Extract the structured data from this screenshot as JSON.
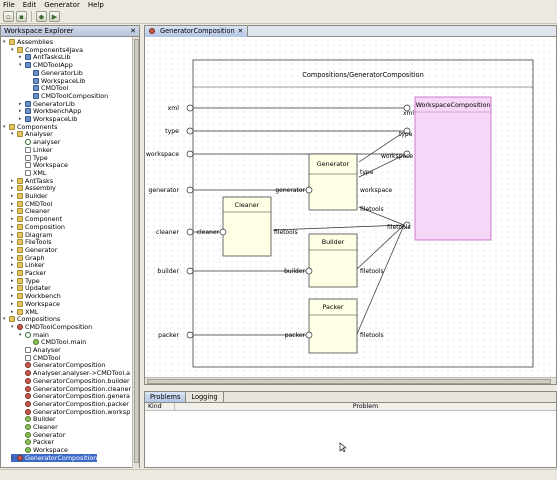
{
  "menu": [
    "File",
    "Edit",
    "Generator",
    "Help"
  ],
  "colors": {
    "selection": "#3d6bc7",
    "component_fill": "#ffffe6",
    "workspace_fill": "#f7d7f7",
    "workspace_border": "#c060c0",
    "tab_active": "#b3c5e6"
  },
  "workspace_explorer": {
    "title": "Workspace Explorer",
    "tree": [
      {
        "label": "Assemblies",
        "depth": 0,
        "icon": "folder-icon",
        "toggle": "open"
      },
      {
        "label": "Components4Java",
        "depth": 1,
        "icon": "folder-icon",
        "toggle": "open"
      },
      {
        "label": "AntTasksLib",
        "depth": 2,
        "icon": "package-icon",
        "toggle": "closed"
      },
      {
        "label": "CMDToolApp",
        "depth": 2,
        "icon": "package-icon",
        "toggle": "open"
      },
      {
        "label": "GeneratorLib",
        "depth": 3,
        "icon": "package-icon",
        "toggle": ""
      },
      {
        "label": "WorkspaceLib",
        "depth": 3,
        "icon": "package-icon",
        "toggle": ""
      },
      {
        "label": "CMDTool",
        "depth": 3,
        "icon": "package-icon",
        "toggle": ""
      },
      {
        "label": "CMDToolComposition",
        "depth": 3,
        "icon": "package-icon",
        "toggle": ""
      },
      {
        "label": "GeneratorLib",
        "depth": 2,
        "icon": "package-icon",
        "toggle": "closed"
      },
      {
        "label": "WorkbenchApp",
        "depth": 2,
        "icon": "package-icon",
        "toggle": "closed"
      },
      {
        "label": "WorkspaceLib",
        "depth": 2,
        "icon": "package-icon",
        "toggle": "closed"
      },
      {
        "label": "Components",
        "depth": 0,
        "icon": "folder-icon",
        "toggle": "open"
      },
      {
        "label": "Analyser",
        "depth": 1,
        "icon": "folder-icon",
        "toggle": "open"
      },
      {
        "label": "analyser",
        "depth": 2,
        "icon": "search-icon",
        "toggle": ""
      },
      {
        "label": "Linker",
        "depth": 2,
        "icon": "file-icon",
        "toggle": ""
      },
      {
        "label": "Type",
        "depth": 2,
        "icon": "file-icon",
        "toggle": ""
      },
      {
        "label": "Workspace",
        "depth": 2,
        "icon": "file-icon",
        "toggle": ""
      },
      {
        "label": "XML",
        "depth": 2,
        "icon": "file-icon",
        "toggle": ""
      },
      {
        "label": "AntTasks",
        "depth": 1,
        "icon": "folder-icon",
        "toggle": "closed"
      },
      {
        "label": "Assembly",
        "depth": 1,
        "icon": "folder-icon",
        "toggle": "closed"
      },
      {
        "label": "Builder",
        "depth": 1,
        "icon": "folder-icon",
        "toggle": "closed"
      },
      {
        "label": "CMDTool",
        "depth": 1,
        "icon": "folder-icon",
        "toggle": "closed"
      },
      {
        "label": "Cleaner",
        "depth": 1,
        "icon": "folder-icon",
        "toggle": "closed"
      },
      {
        "label": "Component",
        "depth": 1,
        "icon": "folder-icon",
        "toggle": "closed"
      },
      {
        "label": "Composition",
        "depth": 1,
        "icon": "folder-icon",
        "toggle": "closed"
      },
      {
        "label": "Diagram",
        "depth": 1,
        "icon": "folder-icon",
        "toggle": "closed"
      },
      {
        "label": "FileTools",
        "depth": 1,
        "icon": "folder-icon",
        "toggle": "closed"
      },
      {
        "label": "Generator",
        "depth": 1,
        "icon": "folder-icon",
        "toggle": "closed"
      },
      {
        "label": "Graph",
        "depth": 1,
        "icon": "folder-icon",
        "toggle": "closed"
      },
      {
        "label": "Linker",
        "depth": 1,
        "icon": "folder-icon",
        "toggle": "closed"
      },
      {
        "label": "Packer",
        "depth": 1,
        "icon": "folder-icon",
        "toggle": "closed"
      },
      {
        "label": "Type",
        "depth": 1,
        "icon": "folder-icon",
        "toggle": "closed"
      },
      {
        "label": "Updater",
        "depth": 1,
        "icon": "folder-icon",
        "toggle": "closed"
      },
      {
        "label": "Workbench",
        "depth": 1,
        "icon": "folder-icon",
        "toggle": "closed"
      },
      {
        "label": "Workspace",
        "depth": 1,
        "icon": "folder-icon",
        "toggle": "closed"
      },
      {
        "label": "XML",
        "depth": 1,
        "icon": "folder-icon",
        "toggle": "closed"
      },
      {
        "label": "Compositions",
        "depth": 0,
        "icon": "folder-icon",
        "toggle": "open"
      },
      {
        "label": "CMDToolComposition",
        "depth": 1,
        "icon": "composition-icon",
        "toggle": "open"
      },
      {
        "label": "main",
        "depth": 2,
        "icon": "search-icon",
        "toggle": "open"
      },
      {
        "label": "CMDTool.main",
        "depth": 3,
        "icon": "function-icon",
        "toggle": ""
      },
      {
        "label": "Analyser",
        "depth": 2,
        "icon": "file-icon",
        "toggle": ""
      },
      {
        "label": "CMDTool",
        "depth": 2,
        "icon": "file-icon",
        "toggle": ""
      },
      {
        "label": "GeneratorComposition",
        "depth": 2,
        "icon": "composition-icon",
        "toggle": ""
      },
      {
        "label": "Analyser.analyser->CMDTool.a",
        "depth": 2,
        "icon": "composition-icon",
        "toggle": ""
      },
      {
        "label": "GeneratorComposition.builder",
        "depth": 2,
        "icon": "composition-icon",
        "toggle": ""
      },
      {
        "label": "GeneratorComposition.cleaner",
        "depth": 2,
        "icon": "composition-icon",
        "toggle": ""
      },
      {
        "label": "GeneratorComposition.genera",
        "depth": 2,
        "icon": "composition-icon",
        "toggle": ""
      },
      {
        "label": "GeneratorComposition.packer",
        "depth": 2,
        "icon": "composition-icon",
        "toggle": ""
      },
      {
        "label": "GeneratorComposition.worksp",
        "depth": 2,
        "icon": "composition-icon",
        "toggle": ""
      },
      {
        "label": "Builder",
        "depth": 2,
        "icon": "fn-icon",
        "toggle": ""
      },
      {
        "label": "Cleaner",
        "depth": 2,
        "icon": "fn-icon",
        "toggle": ""
      },
      {
        "label": "Generator",
        "depth": 2,
        "icon": "fn-icon",
        "toggle": ""
      },
      {
        "label": "Packer",
        "depth": 2,
        "icon": "fn-icon",
        "toggle": ""
      },
      {
        "label": "Workspace",
        "depth": 2,
        "icon": "fn-icon",
        "toggle": ""
      },
      {
        "label": "GeneratorComposition",
        "depth": 1,
        "icon": "composition-icon",
        "toggle": "closed",
        "selected": true
      }
    ]
  },
  "editor": {
    "tab_label": "GeneratorComposition",
    "diagram": {
      "frame_title": "Compositions/GeneratorComposition",
      "boundary_ports": [
        "xml",
        "type",
        "workspace",
        "generator",
        "cleaner",
        "builder",
        "packer"
      ],
      "components": {
        "generator": {
          "title": "Generator",
          "ports": [
            "generator",
            "type",
            "workspace",
            "filetools"
          ]
        },
        "cleaner": {
          "title": "Cleaner",
          "ports": [
            "cleaner",
            "filetools"
          ]
        },
        "builder": {
          "title": "Builder",
          "ports": [
            "builder",
            "filetools"
          ]
        },
        "packer": {
          "title": "Packer",
          "ports": [
            "packer",
            "filetools"
          ]
        },
        "workspace": {
          "title": "WorkspaceComposition",
          "ports": [
            "xml",
            "type",
            "workspace",
            "filetools"
          ]
        }
      }
    }
  },
  "bottom_panel": {
    "tabs": [
      "Problems",
      "Logging"
    ],
    "columns": [
      "Kind",
      "Problem"
    ]
  }
}
